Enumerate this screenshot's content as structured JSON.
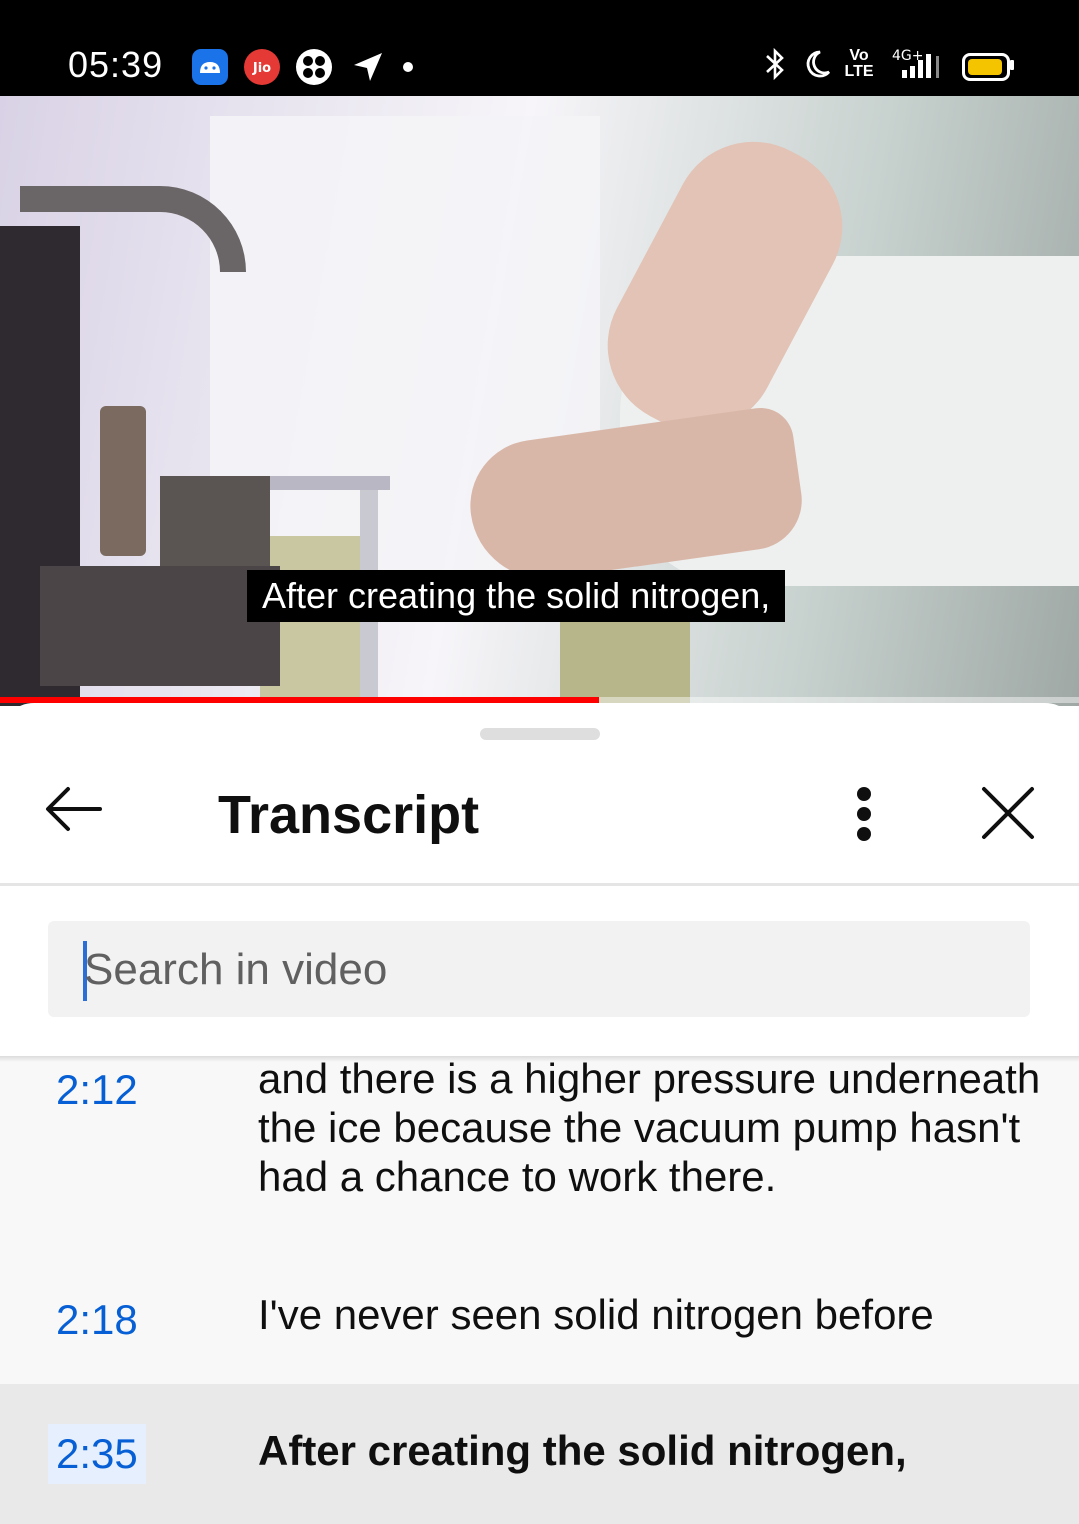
{
  "status_bar": {
    "time": "05:39",
    "icons_left": [
      "android-app-icon",
      "jio-app-icon",
      "fan-app-icon",
      "location-arrow-icon",
      "notification-dot-icon"
    ],
    "icons_right": [
      "bluetooth-icon",
      "moon-icon",
      "volte-icon",
      "signal-4g-icon",
      "battery-icon"
    ],
    "volte_label": "Vo LTE",
    "network_label": "4G+",
    "battery_color": "#f5c400"
  },
  "video": {
    "caption": "After creating the solid nitrogen,",
    "progress": 0.555,
    "progress_color": "#ff0000"
  },
  "transcript_panel": {
    "title": "Transcript",
    "search_placeholder": "Search in video",
    "accent_color": "#065fd4",
    "segments": [
      {
        "time": "2:12",
        "text": "and there is a higher pressure underneath the ice because the vacuum pump hasn't had a chance to work there.",
        "active": false
      },
      {
        "time": "2:18",
        "text": "I've never seen solid nitrogen before",
        "active": false
      },
      {
        "time": "2:35",
        "text": "After creating the solid nitrogen,",
        "active": true
      }
    ]
  }
}
